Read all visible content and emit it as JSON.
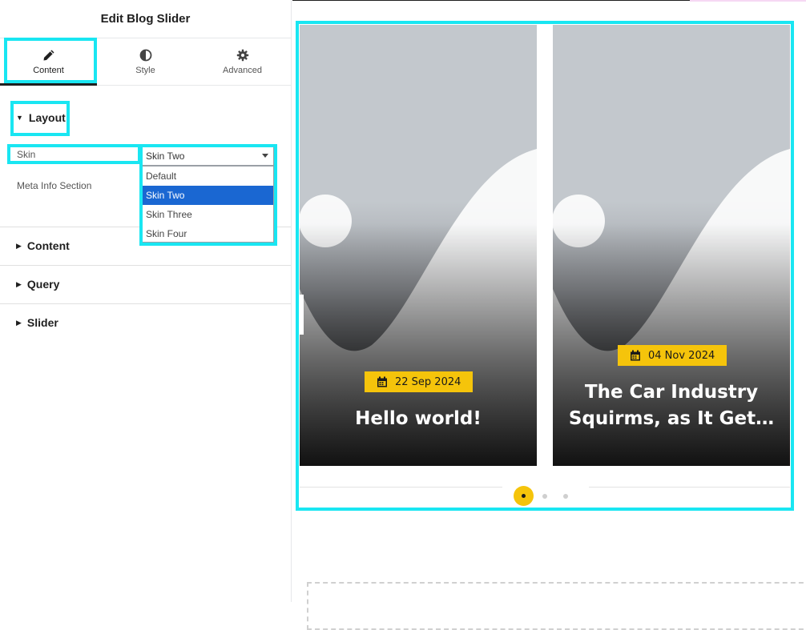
{
  "panel": {
    "title": "Edit Blog Slider",
    "tabs": [
      {
        "label": "Content",
        "icon": "pencil-icon",
        "active": true
      },
      {
        "label": "Style",
        "icon": "half-circle-icon",
        "active": false
      },
      {
        "label": "Advanced",
        "icon": "gear-icon",
        "active": false
      }
    ],
    "sections": {
      "layout": {
        "label": "Layout",
        "expanded": true
      },
      "content": {
        "label": "Content",
        "expanded": false
      },
      "query": {
        "label": "Query",
        "expanded": false
      },
      "slider": {
        "label": "Slider",
        "expanded": false
      }
    },
    "controls": {
      "skin_label": "Skin",
      "skin_value": "Skin Two",
      "skin_options": [
        "Default",
        "Skin Two",
        "Skin Three",
        "Skin Four"
      ],
      "meta_info_label": "Meta Info Section"
    }
  },
  "slider": {
    "slides": [
      {
        "date": "22 Sep 2024",
        "title": "Hello world!"
      },
      {
        "date": "04 Nov 2024",
        "title_line1": "The Car Industry",
        "title_line2": "Squirms, as It Get…"
      }
    ],
    "pagination": {
      "total": 3,
      "active": 1
    }
  },
  "colors": {
    "highlight": "#19e6f2",
    "badge": "#f5c40b",
    "selected_option": "#1a67d2"
  }
}
